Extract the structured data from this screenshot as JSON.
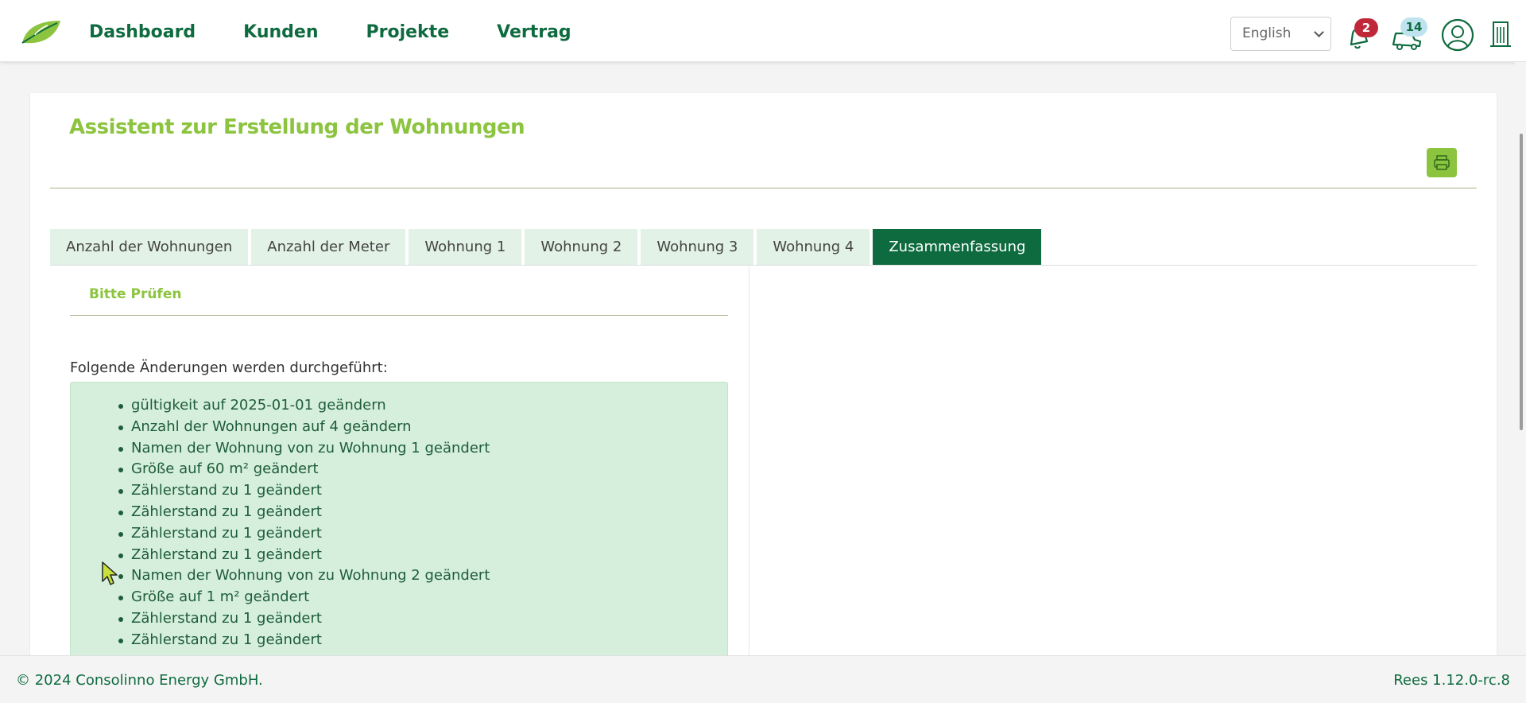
{
  "nav": {
    "links": [
      "Dashboard",
      "Kunden",
      "Projekte",
      "Vertrag"
    ],
    "language": "English",
    "notifications_count": "2",
    "messages_count": "14"
  },
  "page": {
    "title": "Assistent zur Erstellung der Wohnungen"
  },
  "tabs": [
    {
      "label": "Anzahl der Wohnungen",
      "active": false
    },
    {
      "label": "Anzahl der Meter",
      "active": false
    },
    {
      "label": "Wohnung 1",
      "active": false
    },
    {
      "label": "Wohnung 2",
      "active": false
    },
    {
      "label": "Wohnung 3",
      "active": false
    },
    {
      "label": "Wohnung 4",
      "active": false
    },
    {
      "label": "Zusammenfassung",
      "active": true
    }
  ],
  "summary": {
    "heading": "Bitte Prüfen",
    "intro": "Folgende Änderungen werden durchgeführt:",
    "changes": [
      "gültigkeit auf 2025-01-01 geändern",
      "Anzahl der Wohnungen auf 4 geändern",
      "Namen der Wohnung von zu Wohnung 1 geändert",
      "Größe auf 60 m² geändert",
      "Zählerstand zu 1 geändert",
      "Zählerstand zu 1 geändert",
      "Zählerstand zu 1 geändert",
      "Zählerstand zu 1 geändert",
      "Namen der Wohnung von zu Wohnung 2 geändert",
      "Größe auf 1 m² geändert",
      "Zählerstand zu 1 geändert",
      "Zählerstand zu 1 geändert"
    ]
  },
  "footer": {
    "copyright": "© 2024 Consolinno Energy GmbH.",
    "version": "Rees 1.12.0-rc.8"
  },
  "colors": {
    "brand_dark": "#0e6b3f",
    "brand_light": "#8cc43f",
    "summary_bg": "#d5efdc",
    "notification_badge": "#c0283a",
    "message_badge": "#bfe3ee"
  },
  "icons": [
    "leaf-logo-icon",
    "bell-icon",
    "truck-icon",
    "user-icon",
    "building-icon",
    "printer-icon",
    "mouse-pointer-icon"
  ]
}
